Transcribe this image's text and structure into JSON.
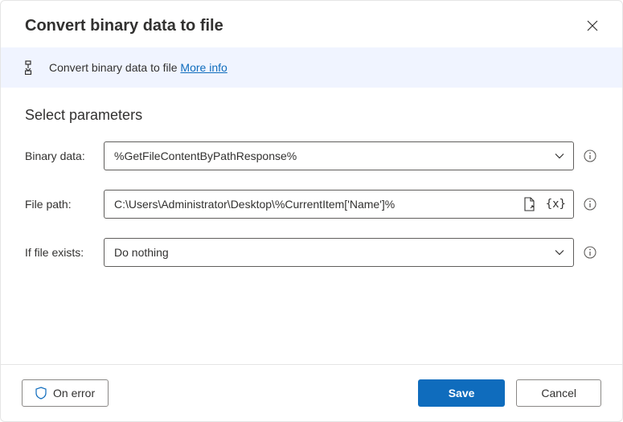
{
  "header": {
    "title": "Convert binary data to file"
  },
  "banner": {
    "text": "Convert binary data to file",
    "more_info": "More info"
  },
  "section_title": "Select parameters",
  "fields": {
    "binary_data": {
      "label": "Binary data:",
      "value": "%GetFileContentByPathResponse%"
    },
    "file_path": {
      "label": "File path:",
      "value": "C:\\Users\\Administrator\\Desktop\\%CurrentItem['Name']%"
    },
    "if_file_exists": {
      "label": "If file exists:",
      "value": "Do nothing"
    }
  },
  "footer": {
    "on_error": "On error",
    "save": "Save",
    "cancel": "Cancel"
  }
}
